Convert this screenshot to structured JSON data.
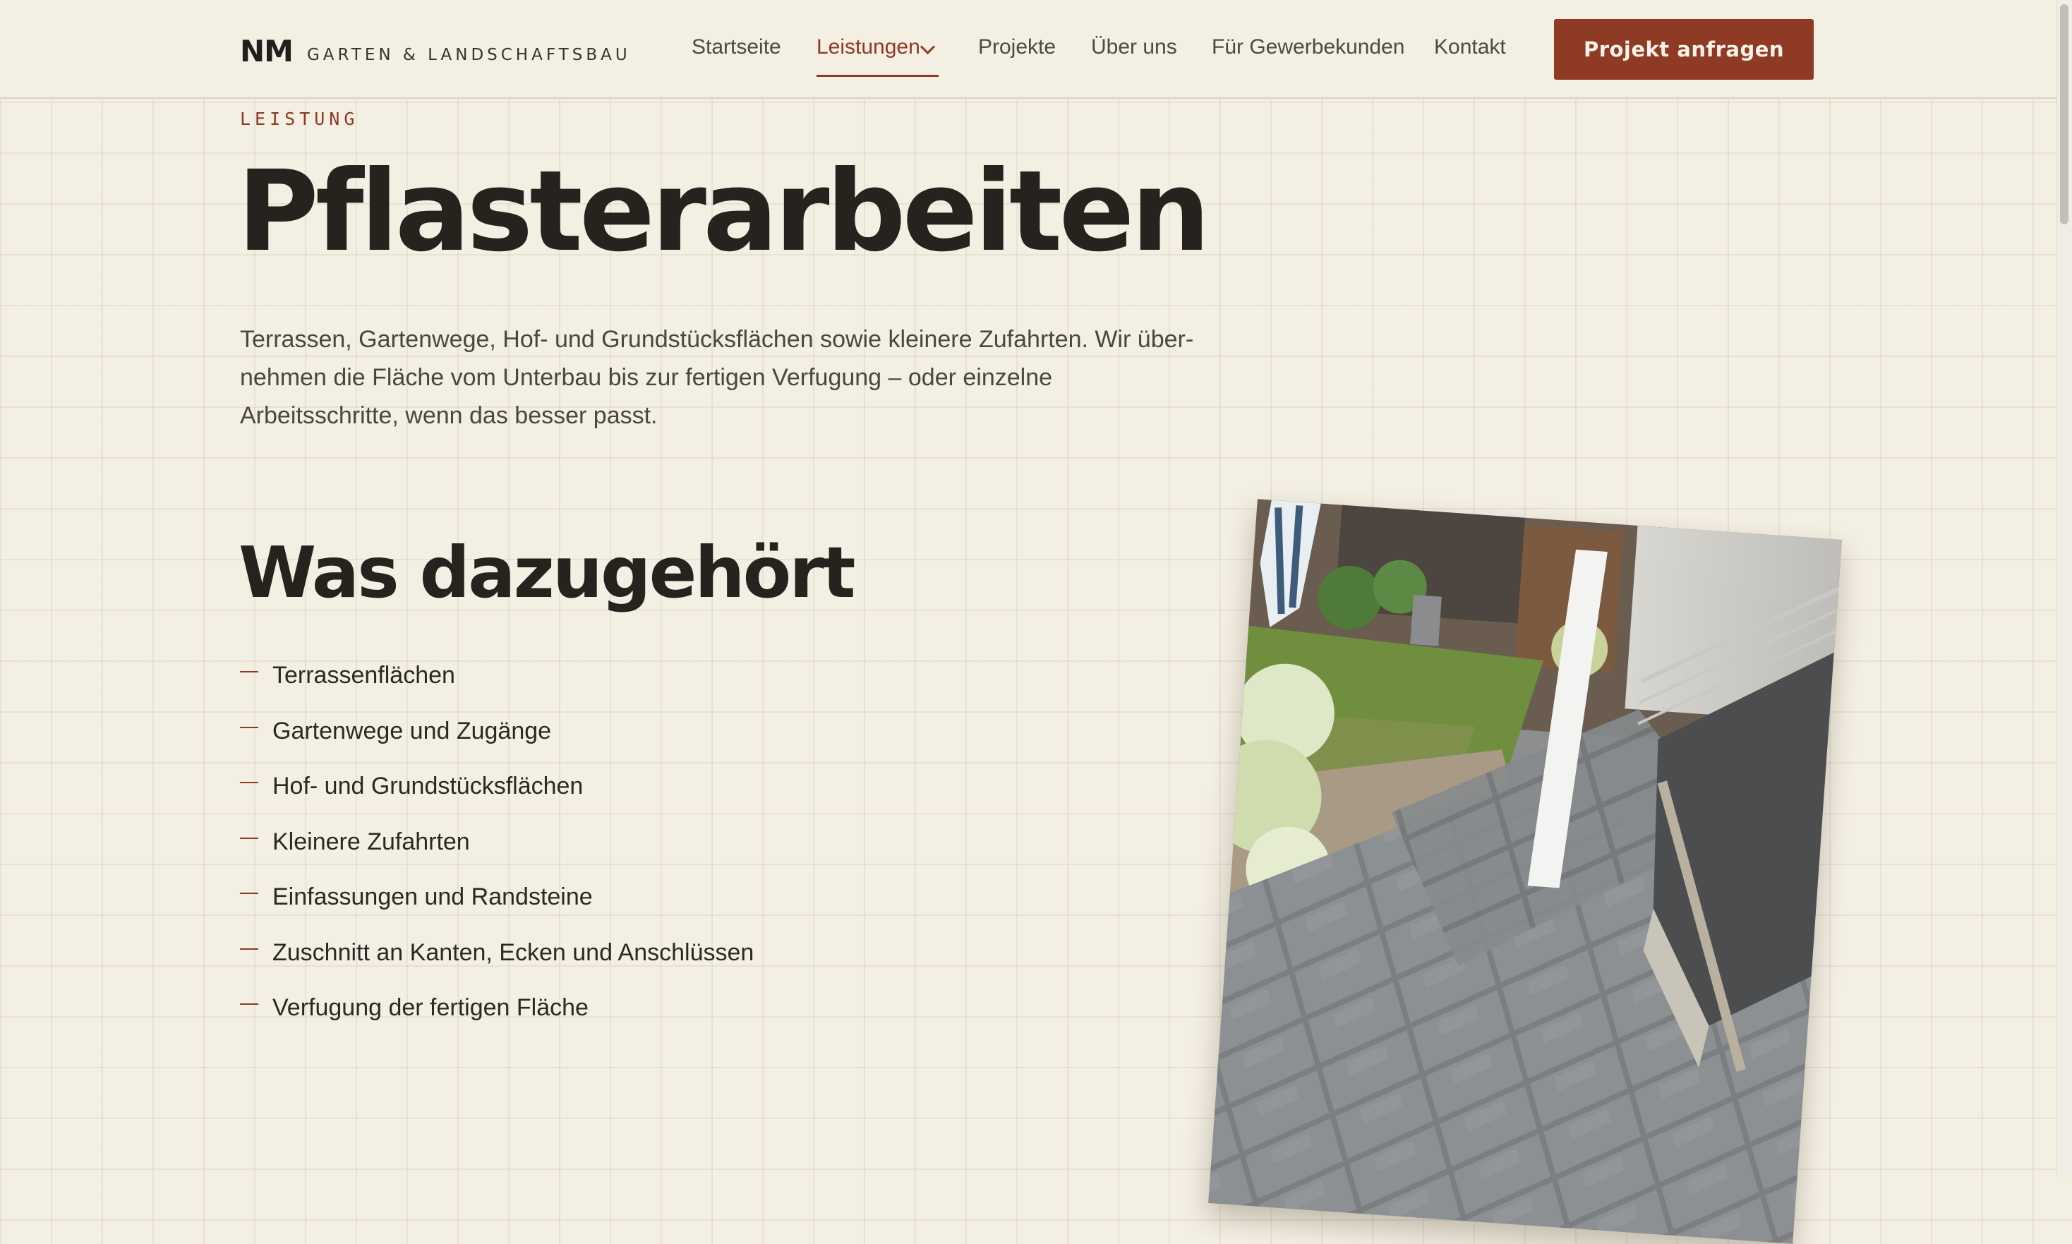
{
  "header": {
    "logo_mark": "NM",
    "logo_text": "GARTEN & LANDSCHAFTSBAU",
    "nav": [
      {
        "label": "Startseite"
      },
      {
        "label": "Leistungen"
      },
      {
        "label": "Projekte"
      },
      {
        "label": "Über uns"
      },
      {
        "label": "Für Gewerbekunden"
      },
      {
        "label": "Kontakt"
      }
    ],
    "cta_label": "Projekt anfragen"
  },
  "hero": {
    "eyebrow": "LEISTUNG",
    "title": "Pflasterarbeiten",
    "intro": "Terrassen, Gartenwege, Hof- und Grundstücksflächen sowie kleinere Zufahrten. Wir über­nehmen die Fläche vom Unterbau bis zur fertigen Verfugung – oder einzelne Arbeitsschritte, wenn das besser passt."
  },
  "scope": {
    "heading": "Was dazugehört",
    "items": [
      "Terrassenflächen",
      "Gartenwege und Zugänge",
      "Hof- und Grundstücksflächen",
      "Kleinere Zufahrten",
      "Einfassungen und Randsteine",
      "Zuschnitt an Kanten, Ecken und Anschlüssen",
      "Verfugung der fertigen Fläche"
    ]
  },
  "colors": {
    "accent": "#8e3a24",
    "background": "#f4efe3",
    "text": "#26231f"
  }
}
